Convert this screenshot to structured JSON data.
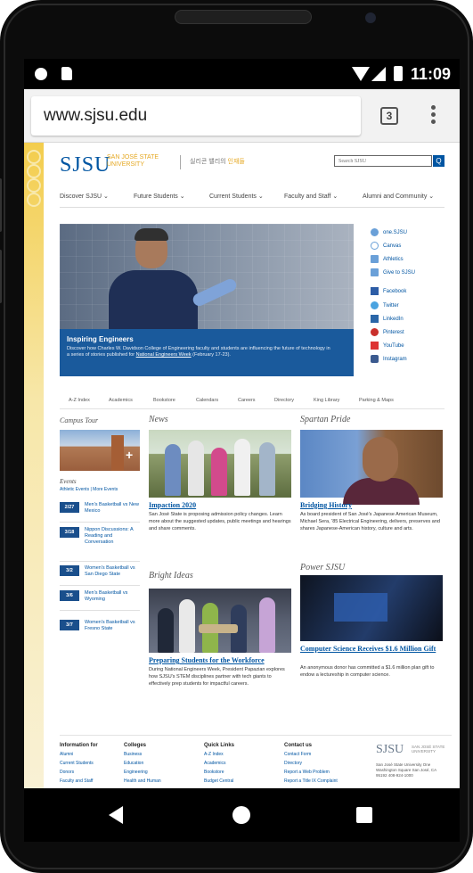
{
  "status_bar": {
    "time": "11:09"
  },
  "browser": {
    "url": "www.sjsu.edu",
    "tab_count": "3"
  },
  "site": {
    "logo": "SJSU",
    "logo_sub": "SAN JOSÉ STATE UNIVERSITY",
    "tagline_pre": "실리콘 밸리의 ",
    "tagline_em": "인재들",
    "search_placeholder": "Search SJSU",
    "search_button": "Q"
  },
  "top_nav": [
    "Discover SJSU ⌄",
    "Future Students ⌄",
    "Current Students ⌄",
    "Faculty and Staff ⌄",
    "Alumni and Community ⌄"
  ],
  "hero": {
    "title": "Inspiring Engineers",
    "text_pre": "Discover how Charles W. Davidson College of Engineering faculty and students are influencing the future of technology in a series of stories published for ",
    "text_link": "National Engineers Week",
    "text_post": " (February 17-23)."
  },
  "quick_links": [
    {
      "label": "one.SJSU",
      "icon": "user-circle-icon"
    },
    {
      "label": "Canvas",
      "icon": "canvas-icon"
    },
    {
      "label": "Athletics",
      "icon": "athletics-icon"
    },
    {
      "label": "Give to SJSU",
      "icon": "gift-icon"
    },
    {
      "label": "Facebook",
      "icon": "facebook-icon"
    },
    {
      "label": "Twitter",
      "icon": "twitter-icon"
    },
    {
      "label": "LinkedIn",
      "icon": "linkedin-icon"
    },
    {
      "label": "Pinterest",
      "icon": "pinterest-icon"
    },
    {
      "label": "YouTube",
      "icon": "youtube-icon"
    },
    {
      "label": "Instagram",
      "icon": "instagram-icon"
    }
  ],
  "sub_nav": [
    "A-Z Index",
    "Academics",
    "Bookstore",
    "Calendars",
    "Careers",
    "Directory",
    "King Library",
    "Parking & Maps"
  ],
  "sections": {
    "campus_tour": "Campus Tour",
    "events": "Events",
    "events_links_a": "Athletic Events",
    "events_links_sep": " | ",
    "events_links_b": "More Events",
    "news": "News",
    "spartan_pride": "Spartan Pride",
    "bright_ideas": "Bright Ideas",
    "power_sjsu": "Power SJSU"
  },
  "events": [
    {
      "date": "2/27",
      "text": "Men's Basketball vs New Mexico"
    },
    {
      "date": "3/18",
      "text": "Nippon Discussions: A Reading and Conversation"
    },
    {
      "date": "3/2",
      "text": "Women's Basketball vs San Diego State"
    },
    {
      "date": "3/6",
      "text": "Men's Basketball vs Wyoming"
    },
    {
      "date": "3/7",
      "text": "Women's Basketball vs Fresno State"
    }
  ],
  "articles": {
    "news": {
      "title": "Impaction 2020",
      "text": "San José State is proposing admission policy changes. Learn more about the suggested updates, public meetings and hearings and share comments."
    },
    "pride": {
      "title": "Bridging History",
      "text": "As board president of San José's Japanese American Museum, Michael Sera, '85 Electrical Engineering, delivers, preserves and shares Japanese-American history, culture and arts."
    },
    "ideas": {
      "title": "Preparing Students for the Workforce",
      "text": "During National Engineers Week, President Papazian explores how SJSU's STEM disciplines partner with tech giants to effectively prep students for impactful careers."
    },
    "power": {
      "title": "Computer Science Receives $1.6 Million Gift",
      "text": "An anonymous donor has committed a $1.6 million plan gift to endow a lectureship in computer science."
    }
  },
  "footer": {
    "cols": [
      {
        "head": "Information for",
        "links": [
          "Alumni",
          "Current Students",
          "Donors",
          "Faculty and Staff"
        ]
      },
      {
        "head": "Colleges",
        "links": [
          "Business",
          "Education",
          "Engineering",
          "Health and Human"
        ]
      },
      {
        "head": "Quick Links",
        "links": [
          "A-Z Index",
          "Academics",
          "Bookstore",
          "Budget Central"
        ]
      },
      {
        "head": "Contact us",
        "links": [
          "Contact Form",
          "Directory",
          "Report a Web Problem",
          "Report a Title IX Complaint"
        ]
      }
    ],
    "logo": "SJSU",
    "logo_sub": "SAN JOSÉ STATE UNIVERSITY",
    "address": "San José State University One Washington Square San José, CA 95192 408-924-1000"
  }
}
